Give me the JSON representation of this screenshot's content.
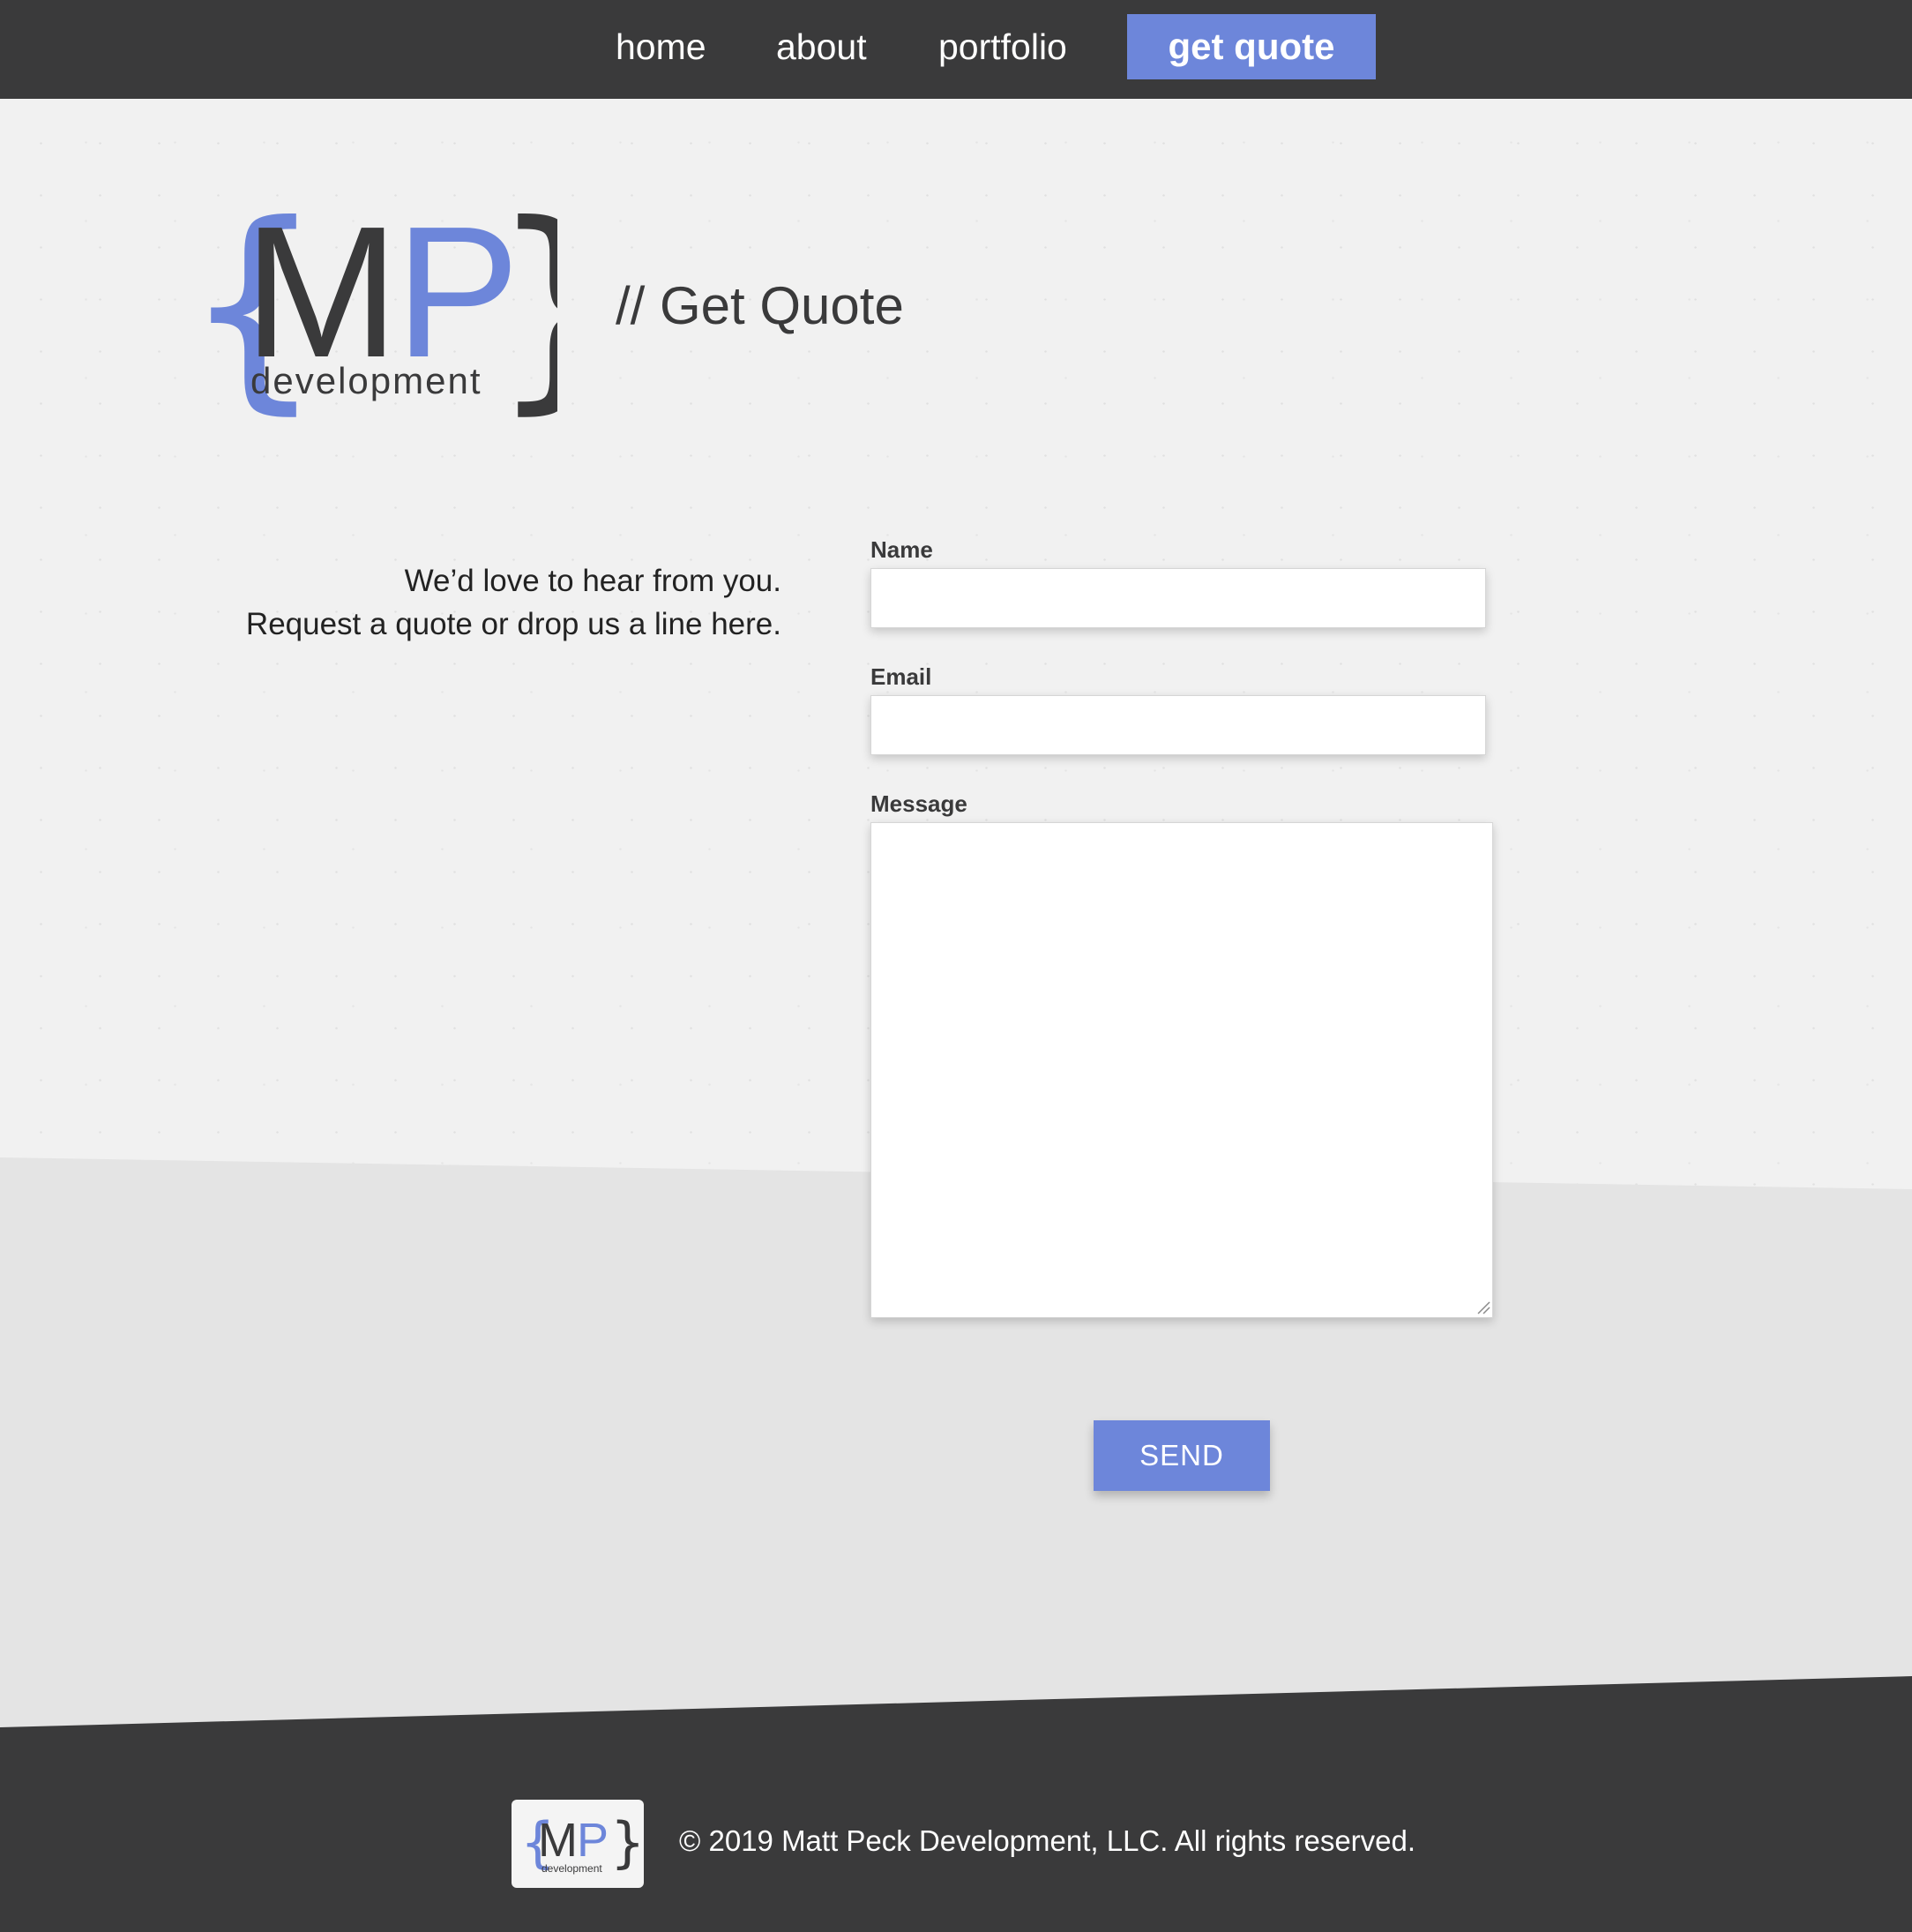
{
  "nav": {
    "items": [
      {
        "label": "home"
      },
      {
        "label": "about"
      },
      {
        "label": "portfolio"
      }
    ],
    "cta_label": "get quote"
  },
  "logo": {
    "letters": "MP",
    "wordmark": "development"
  },
  "page": {
    "title": "// Get Quote"
  },
  "intro": {
    "line1": "We’d love to hear from you.",
    "line2": "Request a quote or drop us a line here."
  },
  "form": {
    "name_label": "Name",
    "name_value": "",
    "email_label": "Email",
    "email_value": "",
    "message_label": "Message",
    "message_value": "",
    "send_label": "SEND"
  },
  "footer": {
    "copyright": "© 2019 Matt Peck Development, LLC. All rights reserved."
  },
  "colors": {
    "accent": "#6d86da",
    "dark": "#3a3a3b",
    "light_bg": "#f1f1f1",
    "mid_bg": "#e4e4e4"
  }
}
